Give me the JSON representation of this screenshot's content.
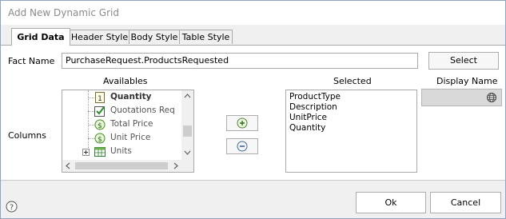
{
  "window": {
    "title": "Add New Dynamic Grid"
  },
  "tabs": [
    {
      "label": "Grid Data",
      "active": true
    },
    {
      "label": "Header Style",
      "active": false
    },
    {
      "label": "Body Style",
      "active": false
    },
    {
      "label": "Table Style",
      "active": false
    }
  ],
  "fact": {
    "label": "Fact Name",
    "value": "PurchaseRequest.ProductsRequested",
    "select_label": "Select"
  },
  "columns": {
    "label": "Columns",
    "availables_header": "Availables",
    "selected_header": "Selected",
    "display_name_header": "Display Name",
    "availables": [
      {
        "label": "Quantity",
        "icon": "number-field-icon",
        "bold": true
      },
      {
        "label": "Quotations Req",
        "icon": "checkbox-field-icon",
        "bold": false
      },
      {
        "label": "Total Price",
        "icon": "currency-field-icon",
        "bold": false
      },
      {
        "label": "Unit Price",
        "icon": "currency-field-icon",
        "bold": false
      },
      {
        "label": "Units",
        "icon": "table-field-icon",
        "bold": false
      }
    ],
    "selected": [
      "ProductType",
      "Description",
      "UnitPrice",
      "Quantity"
    ]
  },
  "footer": {
    "ok_label": "Ok",
    "cancel_label": "Cancel",
    "help_icon": "question-circle-icon"
  }
}
